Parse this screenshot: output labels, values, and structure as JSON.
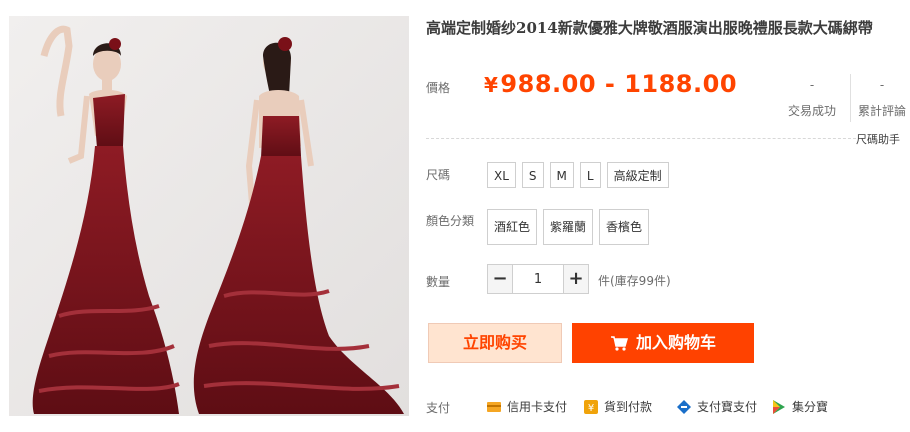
{
  "product": {
    "title": "高端定制婚纱2014新款優雅大牌敬酒服演出服晚禮服長款大碼綁帶"
  },
  "price": {
    "label": "價格",
    "currency": "¥",
    "range": "988.00 - 1188.00",
    "color": "#ff4400"
  },
  "stats": {
    "trades_value": "-",
    "trades_label": "交易成功",
    "reviews_value": "-",
    "reviews_label": "累計評論"
  },
  "size_helper": "尺碼助手",
  "size": {
    "label": "尺碼",
    "options": [
      "XL",
      "S",
      "M",
      "L",
      "高級定制"
    ]
  },
  "color": {
    "label": "顏色分類",
    "options": [
      "酒紅色",
      "紫羅蘭",
      "香檳色"
    ]
  },
  "quantity": {
    "label": "數量",
    "minus": "−",
    "plus": "+",
    "value": "1",
    "stock": "件(庫存99件)"
  },
  "actions": {
    "buy_now": "立即购买",
    "add_to_cart": "加入购物车"
  },
  "payment": {
    "label": "支付",
    "methods": [
      {
        "name": "信用卡支付",
        "icon": "credit-card-icon"
      },
      {
        "name": "貨到付款",
        "icon": "cash-on-delivery-icon"
      },
      {
        "name": "支付寶支付",
        "icon": "alipay-icon"
      },
      {
        "name": "集分寶",
        "icon": "jifenbao-icon"
      }
    ]
  }
}
